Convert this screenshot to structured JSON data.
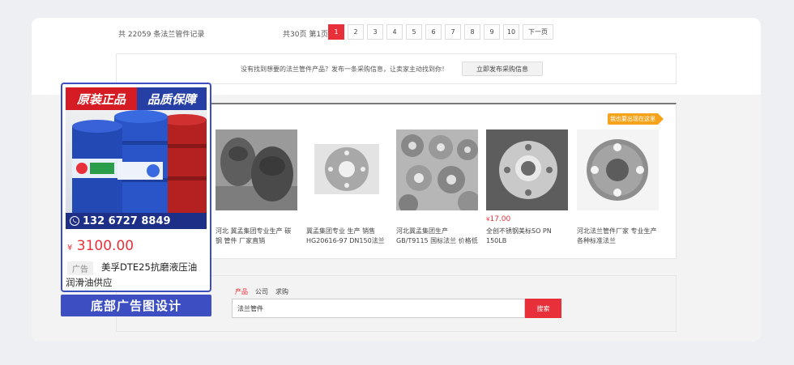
{
  "pagination": {
    "total_text": "共 22059 条法兰管件记录",
    "page_info": "共30页 第1页",
    "pages": [
      "1",
      "2",
      "3",
      "4",
      "5",
      "6",
      "7",
      "8",
      "9",
      "10"
    ],
    "active_page": "1",
    "next_label": "下一页"
  },
  "notice": {
    "text": "没有找到想要的法兰管件产品？发布一条采购信息，让卖家主动找到你！",
    "button_label": "立即发布采购信息"
  },
  "products": {
    "tag_label": "我也要出现在这里",
    "items": [
      {
        "price": "",
        "desc": "河北 冀孟集团专业生产 碳钢 管件 厂家直销"
      },
      {
        "price": "",
        "desc": "冀孟集团专业 生产 销售HG20616-97 DN150法兰"
      },
      {
        "price": "",
        "desc": "河北冀孟集团生产GB/T9115 国标法兰 价格低"
      },
      {
        "price": "17.00",
        "currency": "¥",
        "desc": "全创不锈钢美标SO PN 150LB"
      },
      {
        "price": "",
        "desc": "河北法兰管件厂家 专业生产各种标准法兰"
      }
    ]
  },
  "search": {
    "tabs": [
      "产品",
      "公司",
      "求购"
    ],
    "active_tab": "产品",
    "input_value": "法兰管件",
    "button_label": "搜索"
  },
  "ad": {
    "banner_left": "原装正品",
    "banner_right": "品质保障",
    "phone": "132 6727 8849",
    "currency": "¥",
    "price": "3100.00",
    "badge": "广告",
    "title": "美孚DTE25抗磨液压油 润滑油供应",
    "caption": "底部广告图设计"
  },
  "colors": {
    "accent_red": "#e8303a",
    "ad_blue": "#3c4ec2",
    "tag_orange": "#f5a31a"
  }
}
